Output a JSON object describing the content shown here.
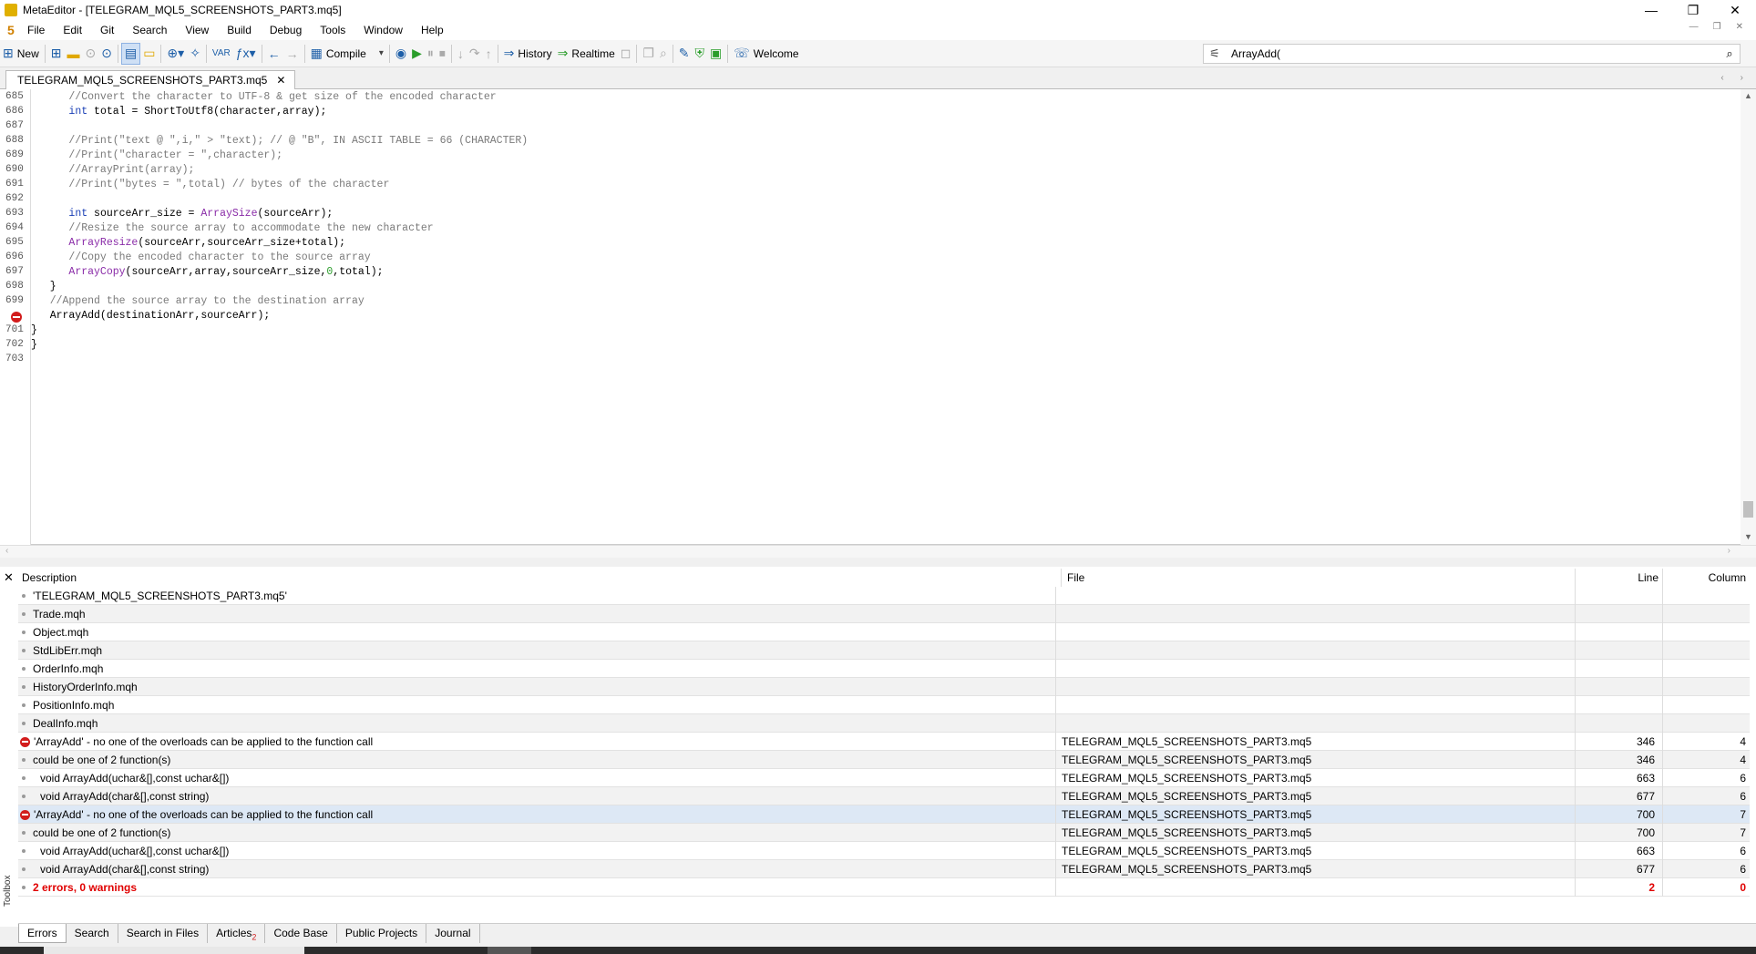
{
  "window": {
    "title": "MetaEditor - [TELEGRAM_MQL5_SCREENSHOTS_PART3.mq5]",
    "minimize": "—",
    "restore": "❐",
    "close": "✕"
  },
  "menu": {
    "logo": "5",
    "items": [
      "File",
      "Edit",
      "Git",
      "Search",
      "View",
      "Build",
      "Debug",
      "Tools",
      "Window",
      "Help"
    ]
  },
  "toolbar": {
    "new_label": "New",
    "compile_label": "Compile",
    "history_label": "History",
    "realtime_label": "Realtime",
    "welcome_label": "Welcome",
    "search_value": "ArrayAdd("
  },
  "editor_tab": {
    "filename": "TELEGRAM_MQL5_SCREENSHOTS_PART3.mq5"
  },
  "code_lines": [
    {
      "n": "685",
      "text": "      //Convert the character to UTF-8 & get size of the encoded character"
    },
    {
      "n": "686",
      "text": "      int total = ShortToUtf8(character,array);"
    },
    {
      "n": "687",
      "text": ""
    },
    {
      "n": "688",
      "text": "      //Print(\"text @ \",i,\" > \"text); // @ \"B\", IN ASCII TABLE = 66 (CHARACTER)"
    },
    {
      "n": "689",
      "text": "      //Print(\"character = \",character);"
    },
    {
      "n": "690",
      "text": "      //ArrayPrint(array);"
    },
    {
      "n": "691",
      "text": "      //Print(\"bytes = \",total) // bytes of the character"
    },
    {
      "n": "692",
      "text": ""
    },
    {
      "n": "693",
      "text": "      int sourceArr_size = ArraySize(sourceArr);"
    },
    {
      "n": "694",
      "text": "      //Resize the source array to accommodate the new character"
    },
    {
      "n": "695",
      "text": "      ArrayResize(sourceArr,sourceArr_size+total);"
    },
    {
      "n": "696",
      "text": "      //Copy the encoded character to the source array"
    },
    {
      "n": "697",
      "text": "      ArrayCopy(sourceArr,array,sourceArr_size,0,total);"
    },
    {
      "n": "698",
      "text": "   }"
    },
    {
      "n": "699",
      "text": "   //Append the source array to the destination array"
    },
    {
      "n": "700",
      "text": "   ArrayAdd(destinationArr,sourceArr);"
    },
    {
      "n": "701",
      "text": "}"
    },
    {
      "n": "702",
      "text": "}"
    },
    {
      "n": "703",
      "text": ""
    }
  ],
  "errors_panel": {
    "headers": {
      "description": "Description",
      "file": "File",
      "line": "Line",
      "column": "Column"
    },
    "rows": [
      {
        "type": "info",
        "desc": "'TELEGRAM_MQL5_SCREENSHOTS_PART3.mq5'",
        "file": "",
        "line": "",
        "col": ""
      },
      {
        "type": "info",
        "desc": "Trade.mqh",
        "file": "",
        "line": "",
        "col": ""
      },
      {
        "type": "info",
        "desc": "Object.mqh",
        "file": "",
        "line": "",
        "col": ""
      },
      {
        "type": "info",
        "desc": "StdLibErr.mqh",
        "file": "",
        "line": "",
        "col": ""
      },
      {
        "type": "info",
        "desc": "OrderInfo.mqh",
        "file": "",
        "line": "",
        "col": ""
      },
      {
        "type": "info",
        "desc": "HistoryOrderInfo.mqh",
        "file": "",
        "line": "",
        "col": ""
      },
      {
        "type": "info",
        "desc": "PositionInfo.mqh",
        "file": "",
        "line": "",
        "col": ""
      },
      {
        "type": "info",
        "desc": "DealInfo.mqh",
        "file": "",
        "line": "",
        "col": ""
      },
      {
        "type": "error",
        "desc": "'ArrayAdd' - no one of the overloads can be applied to the function call",
        "file": "TELEGRAM_MQL5_SCREENSHOTS_PART3.mq5",
        "line": "346",
        "col": "4"
      },
      {
        "type": "info",
        "desc": "could be one of 2 function(s)",
        "file": "TELEGRAM_MQL5_SCREENSHOTS_PART3.mq5",
        "line": "346",
        "col": "4"
      },
      {
        "type": "sub",
        "desc": "void ArrayAdd(uchar&[],const uchar&[])",
        "file": "TELEGRAM_MQL5_SCREENSHOTS_PART3.mq5",
        "line": "663",
        "col": "6"
      },
      {
        "type": "sub",
        "desc": "void ArrayAdd(char&[],const string)",
        "file": "TELEGRAM_MQL5_SCREENSHOTS_PART3.mq5",
        "line": "677",
        "col": "6"
      },
      {
        "type": "error",
        "desc": "'ArrayAdd' - no one of the overloads can be applied to the function call",
        "file": "TELEGRAM_MQL5_SCREENSHOTS_PART3.mq5",
        "line": "700",
        "col": "7"
      },
      {
        "type": "info",
        "desc": "could be one of 2 function(s)",
        "file": "TELEGRAM_MQL5_SCREENSHOTS_PART3.mq5",
        "line": "700",
        "col": "7"
      },
      {
        "type": "sub",
        "desc": "void ArrayAdd(uchar&[],const uchar&[])",
        "file": "TELEGRAM_MQL5_SCREENSHOTS_PART3.mq5",
        "line": "663",
        "col": "6"
      },
      {
        "type": "sub",
        "desc": "void ArrayAdd(char&[],const string)",
        "file": "TELEGRAM_MQL5_SCREENSHOTS_PART3.mq5",
        "line": "677",
        "col": "6"
      },
      {
        "type": "summary",
        "desc": "2 errors, 0 warnings",
        "file": "",
        "line": "2",
        "col": "0"
      }
    ],
    "toolbox_label": "Toolbox"
  },
  "bottom_tabs": [
    {
      "label": "Errors",
      "badge": ""
    },
    {
      "label": "Search",
      "badge": ""
    },
    {
      "label": "Search in Files",
      "badge": ""
    },
    {
      "label": "Articles",
      "badge": "2"
    },
    {
      "label": "Code Base",
      "badge": ""
    },
    {
      "label": "Public Projects",
      "badge": ""
    },
    {
      "label": "Journal",
      "badge": ""
    }
  ]
}
